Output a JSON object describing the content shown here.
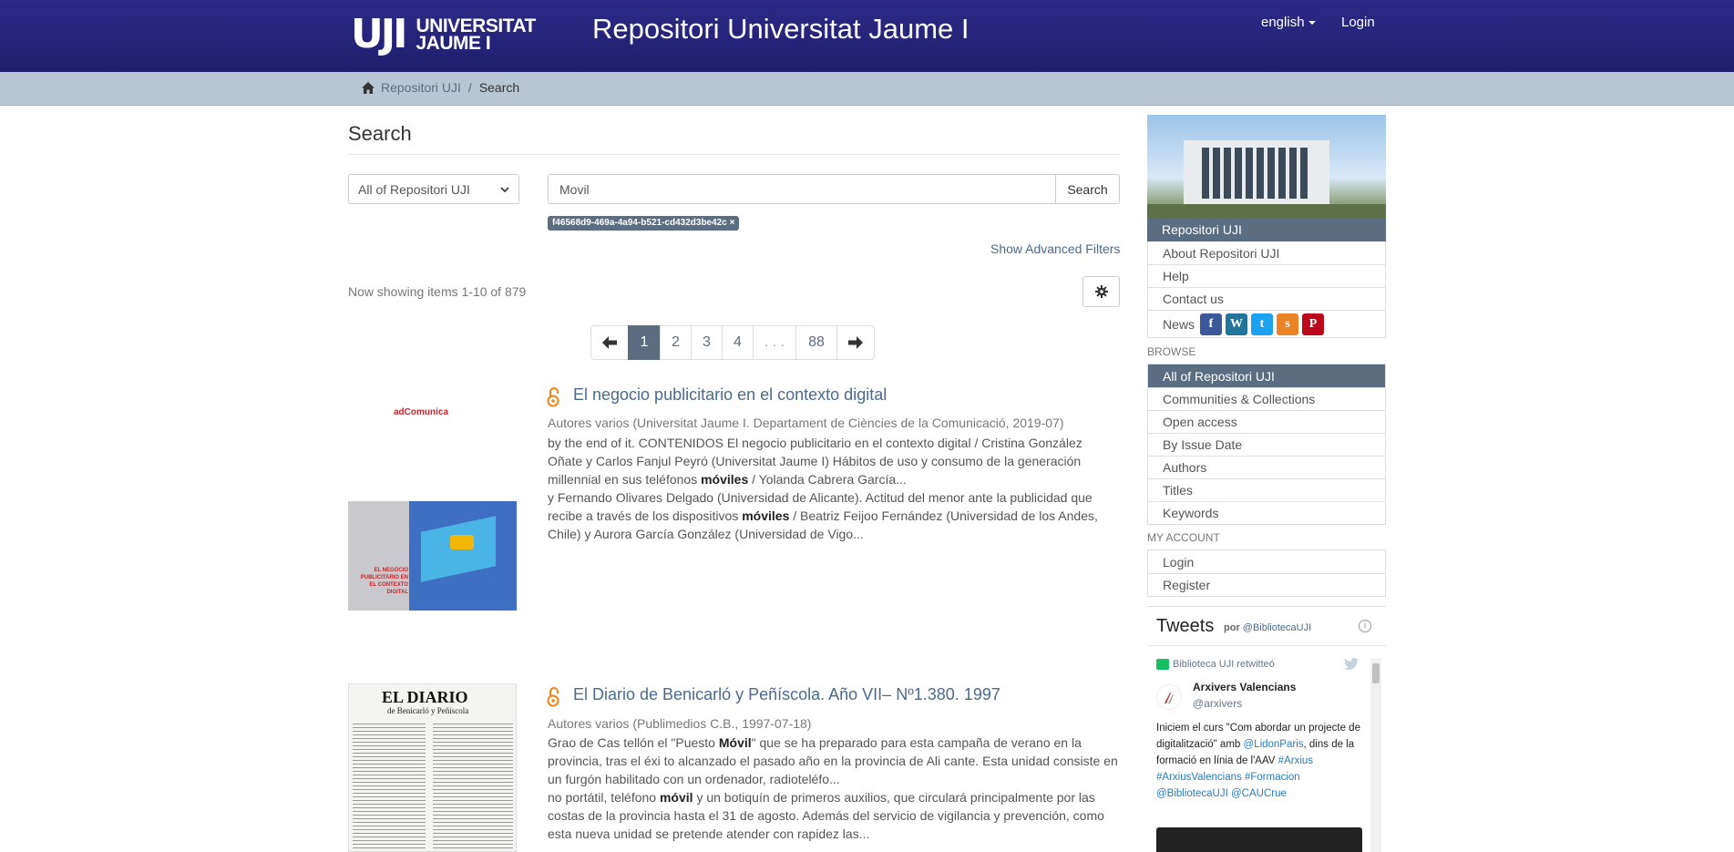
{
  "header": {
    "logo_mark": "UJI",
    "logo_line1": "UNIVERSITAT",
    "logo_line2": "JAUME I",
    "site_title": "Repositori Universitat Jaume I",
    "language": "english",
    "login": "Login"
  },
  "breadcrumb": {
    "home": "Repositori UJI",
    "separator": "/",
    "current": "Search"
  },
  "search": {
    "heading": "Search",
    "scope": "All of Repositori UJI",
    "query": "Movil",
    "button": "Search",
    "filter_tag": "f46568d9-469a-4a94-b521-cd432d3be42c ×",
    "advanced_filters": "Show Advanced Filters",
    "showing": "Now showing items 1-10 of 879"
  },
  "pagination": [
    "1",
    "2",
    "3",
    "4",
    ". . .",
    "88"
  ],
  "pagination_active": "1",
  "results": [
    {
      "title": "El negocio publicitario en el contexto digital",
      "meta": "Autores varios (Universitat Jaume I. Departament de Ciències de la Comunicació, 2019-07)",
      "thumb_brand": "adComunica",
      "thumb_caption": "EL NEGOCIO PUBLICITARIO EN EL CONTEXTO DIGITAL",
      "snippet1_a": "by the end of it. CONTENIDOS El negocio publicitario en el contexto digital / Cristina González Oñate y Carlos Fanjul Peyró (Universitat Jaume I) Hábitos de uso y consumo de la generación millennial en sus teléfonos ",
      "snippet1_hl": "móviles",
      "snippet1_b": " / Yolanda Cabrera García...",
      "snippet2_a": "y Fernando Olivares Delgado (Universidad de Alicante). Actitud del menor ante la publicidad que recibe a través de los dispositivos ",
      "snippet2_hl": "móviles",
      "snippet2_b": " / Beatriz Feijoo Fernández (Universidad de los Andes, Chile) y Aurora García González (Universidad de Vigo..."
    },
    {
      "title": "El Diario de Benicarló y Peñíscola. Año VII– Nº1.380. 1997",
      "meta": "Autores varios (Publimedios C.B., 1997-07-18)",
      "thumb_masthead": "EL DIARIO",
      "thumb_subhead": "de Benicarló y Peñíscola",
      "snippet1_a": "Grao de Cas tellón el \"Puesto ",
      "snippet1_hl": "Móvil",
      "snippet1_b": "\" que se ha preparado para esta campaña de verano en la provincia, tras el éxi to alcanzado el pasado año en la provincia de Ali cante. Esta unidad consiste en un furgón habilitado con un ordenador, radioteléfo...",
      "snippet2_a": "no portátil, teléfono ",
      "snippet2_hl": "móvil",
      "snippet2_b": " y un botiquín de primeros auxilios, que circulará principalmente por las costas de la provincia hasta el 31 de agosto. Además del servicio de vigilancia y prevención, como esta nueva unidad se pretende atender con rapidez las..."
    }
  ],
  "sidebar": {
    "repo_head": "Repositori UJI",
    "repo_items": [
      "About Repositori UJI",
      "Help",
      "Contact us"
    ],
    "news_label": "News",
    "social_icons": [
      "facebook-icon",
      "wordpress-icon",
      "twitter-icon",
      "slideshare-icon",
      "pinterest-icon"
    ],
    "browse_label": "BROWSE",
    "browse_items": [
      "All of Repositori UJI",
      "Communities & Collections",
      "Open access",
      "By Issue Date",
      "Authors",
      "Titles",
      "Keywords"
    ],
    "browse_active": "All of Repositori UJI",
    "account_label": "MY ACCOUNT",
    "account_items": [
      "Login",
      "Register"
    ]
  },
  "tweets": {
    "title": "Tweets",
    "by": "por",
    "by_handle": "@BibliotecaUJI",
    "retweet": "Biblioteca UJI retwitteó",
    "author_name": "Arxivers Valencians",
    "author_handle": "@arxivers",
    "text_1": "Iniciem el curs \"Com abordar un projecte de digitalització\" amb ",
    "mention_1": "@LidonParis",
    "text_2": ", dins de la formació en línia de l'AAV ",
    "tag_1": "#Arxius",
    "tag_2": "#ArxiusValencians",
    "tag_3": "#Formacion",
    "mention_2": "@BibliotecaUJI",
    "mention_3": "@CAUCrue"
  },
  "colors": {
    "header": "#2c2a87",
    "breadcrumb_bar": "#b8c6d4",
    "accent": "#5b6d80",
    "link": "#4a6a8f",
    "open_access": "#f68212"
  }
}
